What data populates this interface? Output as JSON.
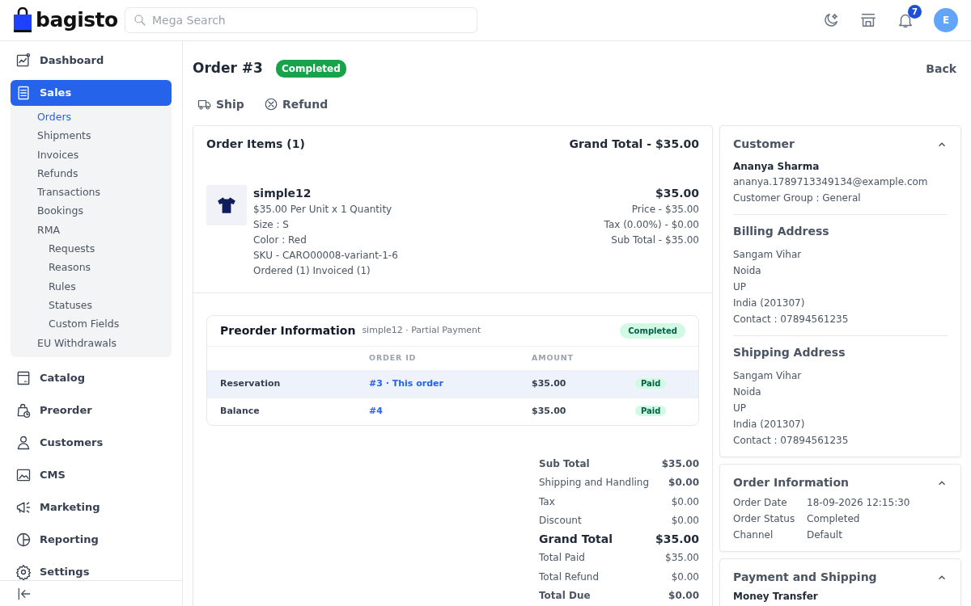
{
  "header": {
    "logo": "bagisto",
    "search": {
      "placeholder": "Mega Search"
    },
    "notifications": "7",
    "avatar": "E"
  },
  "sidebar": {
    "items": [
      {
        "label": "Dashboard",
        "selected": false
      },
      {
        "label": "Sales",
        "selected": true,
        "expanded": true,
        "children": [
          {
            "label": "Orders",
            "selected": true
          },
          {
            "label": "Shipments",
            "selected": false
          },
          {
            "label": "Invoices",
            "selected": false
          },
          {
            "label": "Refunds",
            "selected": false
          },
          {
            "label": "Transactions",
            "selected": false
          },
          {
            "label": "Bookings",
            "selected": false
          },
          {
            "label": "RMA",
            "selected": false,
            "children": [
              {
                "label": "Requests",
                "selected": false
              },
              {
                "label": "Reasons",
                "selected": false
              },
              {
                "label": "Rules",
                "selected": false
              },
              {
                "label": "Statuses",
                "selected": false
              },
              {
                "label": "Custom Fields",
                "selected": false
              }
            ]
          },
          {
            "label": "EU Withdrawals",
            "selected": false
          }
        ]
      },
      {
        "label": "Catalog",
        "selected": false
      },
      {
        "label": "Preorder",
        "selected": false
      },
      {
        "label": "Customers",
        "selected": false
      },
      {
        "label": "CMS",
        "selected": false
      },
      {
        "label": "Marketing",
        "selected": false
      },
      {
        "label": "Reporting",
        "selected": false
      },
      {
        "label": "Settings",
        "selected": false
      }
    ]
  },
  "page": {
    "title": "Order #3",
    "status": "Completed",
    "back": "Back",
    "actions": [
      "Ship",
      "Refund"
    ]
  },
  "order_items": {
    "title": "Order Items (1)",
    "grand_total": "Grand Total - $35.00",
    "items": [
      {
        "name": "simple12",
        "details": [
          "$35.00 Per Unit x 1 Quantity",
          "Size : S",
          "Color : Red",
          "SKU - CARO00008-variant-1-6",
          "Ordered (1) Invoiced (1)"
        ],
        "total": "$35.00",
        "prices": [
          "Price - $35.00",
          "Tax (0.00%) - $0.00",
          "Sub Total - $35.00"
        ]
      }
    ]
  },
  "preorder": {
    "title": "Preorder Information",
    "subtitle": "simple12 · Partial Payment",
    "status": "Completed",
    "columns": [
      "ORDER ID",
      "AMOUNT"
    ],
    "rows": [
      {
        "label": "Reservation",
        "order_id": "#3 · This order",
        "amount": "$35.00",
        "status": "Paid",
        "current": true
      },
      {
        "label": "Balance",
        "order_id": "#4",
        "amount": "$35.00",
        "status": "Paid",
        "current": false
      }
    ]
  },
  "totals": [
    {
      "label": "Sub Total",
      "value": "$35.00",
      "kind": "bold"
    },
    {
      "label": "Shipping and Handling",
      "value": "$0.00",
      "kind": "value-bold"
    },
    {
      "label": "Tax",
      "value": "$0.00",
      "kind": "plain"
    },
    {
      "label": "Discount",
      "value": "$0.00",
      "kind": "plain"
    },
    {
      "label": "Grand Total",
      "value": "$35.00",
      "kind": "grand"
    },
    {
      "label": "Total Paid",
      "value": "$35.00",
      "kind": "plain"
    },
    {
      "label": "Total Refund",
      "value": "$0.00",
      "kind": "plain"
    },
    {
      "label": "Total Due",
      "value": "$0.00",
      "kind": "bold"
    }
  ],
  "customer_panel": {
    "title": "Customer",
    "expanded": true,
    "name": "Ananya Sharma",
    "email": "ananya.1789713349134@example.com",
    "group": "Customer Group : General",
    "sections": [
      {
        "title": "Billing Address",
        "lines": [
          "Sangam Vihar",
          "Noida",
          "UP",
          "India (201307)",
          "Contact : 07894561235"
        ]
      },
      {
        "title": "Shipping Address",
        "lines": [
          "Sangam Vihar",
          "Noida",
          "UP",
          "India (201307)",
          "Contact : 07894561235"
        ]
      }
    ]
  },
  "order_information": {
    "title": "Order Information",
    "expanded": true,
    "fields": [
      {
        "label": "Order Date",
        "value": "18-09-2026 12:15:30"
      },
      {
        "label": "Order Status",
        "value": "Completed"
      },
      {
        "label": "Channel",
        "value": "Default"
      }
    ]
  },
  "payment_shipping": {
    "title": "Payment and Shipping",
    "expanded": true,
    "method": "Money Transfer"
  }
}
